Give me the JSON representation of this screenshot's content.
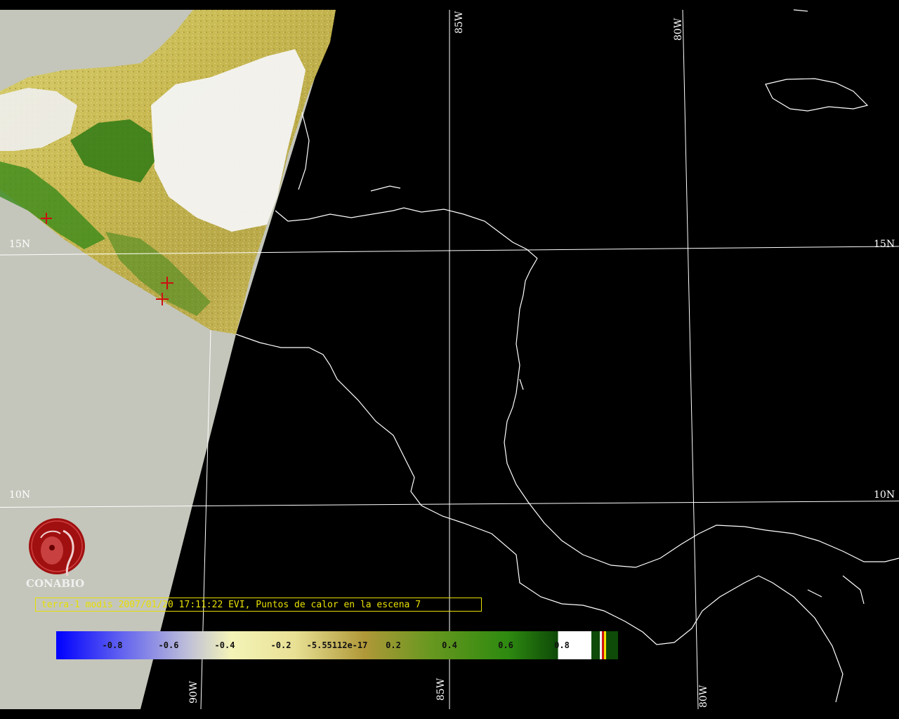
{
  "grid_labels": {
    "lon_top_85": "85W",
    "lon_top_80": "80W",
    "lat_left_15": "15N",
    "lat_right_15": "15N",
    "lat_left_10": "10N",
    "lat_right_10": "10N",
    "lon_bottom_90": "90W",
    "lon_bottom_85": "85W",
    "lon_bottom_80": "80W"
  },
  "caption": "terra-1 modis 2007/01/20 17:11:22 EVI, Puntos de calor en la escena 7",
  "logo": {
    "text": "CONABIO",
    "icon": "conabio-macaw-seal"
  },
  "colorbar": {
    "ticks": [
      "-0.8",
      "-0.6",
      "-0.4",
      "-0.2",
      "-5.55112e-17",
      "0.2",
      "0.4",
      "0.6",
      "0.8"
    ],
    "colors": [
      "#0000ff",
      "#8080f0",
      "#c8c8d8",
      "#f0f0b0",
      "#e8e090",
      "#b09a3a",
      "#709a20",
      "#2e8a10",
      "#104a08"
    ]
  },
  "colors": {
    "no_data": "#c4c6bb",
    "grid": "#ffffff",
    "coast": "#ffffff",
    "caption": "#e8e000",
    "fire_mark": "#cc1111"
  },
  "fire_points_count_label": "7"
}
